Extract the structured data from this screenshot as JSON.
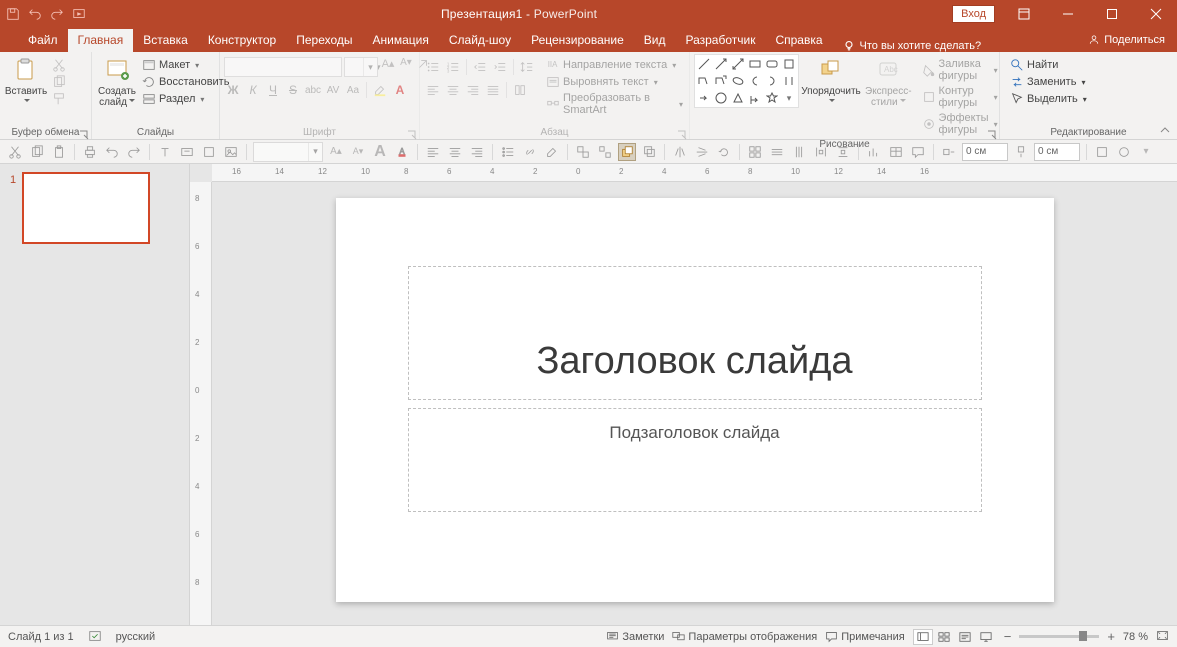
{
  "title_bar": {
    "document_name": "Презентация1",
    "separator": " - ",
    "app_name": "PowerPoint",
    "login_button": "Вход"
  },
  "tabs": {
    "file": "Файл",
    "home": "Главная",
    "insert": "Вставка",
    "design": "Конструктор",
    "transitions": "Переходы",
    "animations": "Анимация",
    "slideshow": "Слайд-шоу",
    "review": "Рецензирование",
    "view": "Вид",
    "developer": "Разработчик",
    "help": "Справка",
    "tell_me": "Что вы хотите сделать?",
    "share": "Поделиться"
  },
  "ribbon": {
    "clipboard": {
      "label": "Буфер обмена",
      "paste": "Вставить"
    },
    "slides": {
      "label": "Слайды",
      "new_slide": "Создать\nслайд",
      "layout": "Макет",
      "reset": "Восстановить",
      "section": "Раздел"
    },
    "font": {
      "label": "Шрифт",
      "font_name": "",
      "font_size": "",
      "bold": "Ж",
      "italic": "К",
      "underline": "Ч",
      "strike": "S",
      "shadow": "abc",
      "spacing": "AV",
      "case": "Aa"
    },
    "paragraph": {
      "label": "Абзац",
      "text_dir": "Направление текста",
      "align_text": "Выровнять текст",
      "smartart": "Преобразовать в SmartArt"
    },
    "drawing": {
      "label": "Рисование",
      "arrange": "Упорядочить",
      "quick_styles": "Экспресс-\nстили",
      "shape_fill": "Заливка фигуры",
      "shape_outline": "Контур фигуры",
      "shape_effects": "Эффекты фигуры"
    },
    "editing": {
      "label": "Редактирование",
      "find": "Найти",
      "replace": "Заменить",
      "select": "Выделить"
    }
  },
  "extra_bar": {
    "spin1": "0 см",
    "spin2": "0 см"
  },
  "slide": {
    "thumb_number": "1",
    "title_placeholder": "Заголовок слайда",
    "subtitle_placeholder": "Подзаголовок слайда"
  },
  "status": {
    "slide_counter": "Слайд 1 из 1",
    "language": "русский",
    "notes": "Заметки",
    "display_settings": "Параметры отображения",
    "comments": "Примечания",
    "zoom": "78 %"
  },
  "ruler_h": [
    "16",
    "14",
    "12",
    "10",
    "8",
    "6",
    "4",
    "2",
    "0",
    "2",
    "4",
    "6",
    "8",
    "10",
    "12",
    "14",
    "16"
  ],
  "ruler_v": [
    "8",
    "6",
    "4",
    "2",
    "0",
    "2",
    "4",
    "6",
    "8"
  ]
}
